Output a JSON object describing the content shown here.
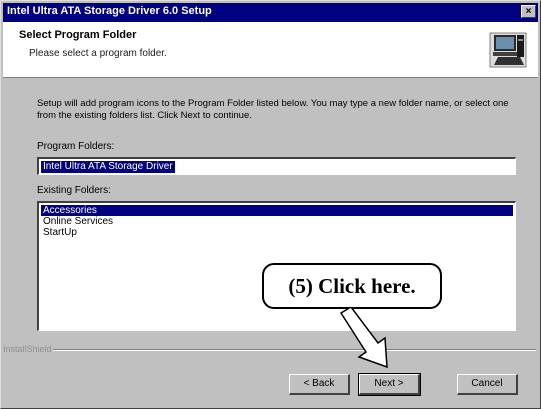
{
  "window": {
    "title": "Intel Ultra ATA Storage Driver 6.0 Setup",
    "close_glyph": "×"
  },
  "header": {
    "title": "Select Program Folder",
    "subtitle": "Please select a program folder.",
    "icon": "computer-setup-icon"
  },
  "body": {
    "description": "Setup will add program icons to the Program Folder listed below. You may type a new folder name, or select one from the existing folders list. Click Next to continue.",
    "program_folder_label": "Program Folders:",
    "program_folder_value": "Intel Ultra ATA Storage Driver",
    "existing_folders_label": "Existing Folders:",
    "existing_folders": [
      "Accessories",
      "Online Services",
      "StartUp"
    ],
    "selected_folder_index": 0
  },
  "footer": {
    "brand": "InstallShield",
    "back_label": "< Back",
    "next_label": "Next >",
    "cancel_label": "Cancel"
  },
  "annotation": {
    "callout_text": "(5)  Click here.",
    "arrow": "arrow-pointing-to-next-button"
  },
  "colors": {
    "titlebar": "#000080",
    "selection": "#000080",
    "face": "#c0c0c0"
  }
}
